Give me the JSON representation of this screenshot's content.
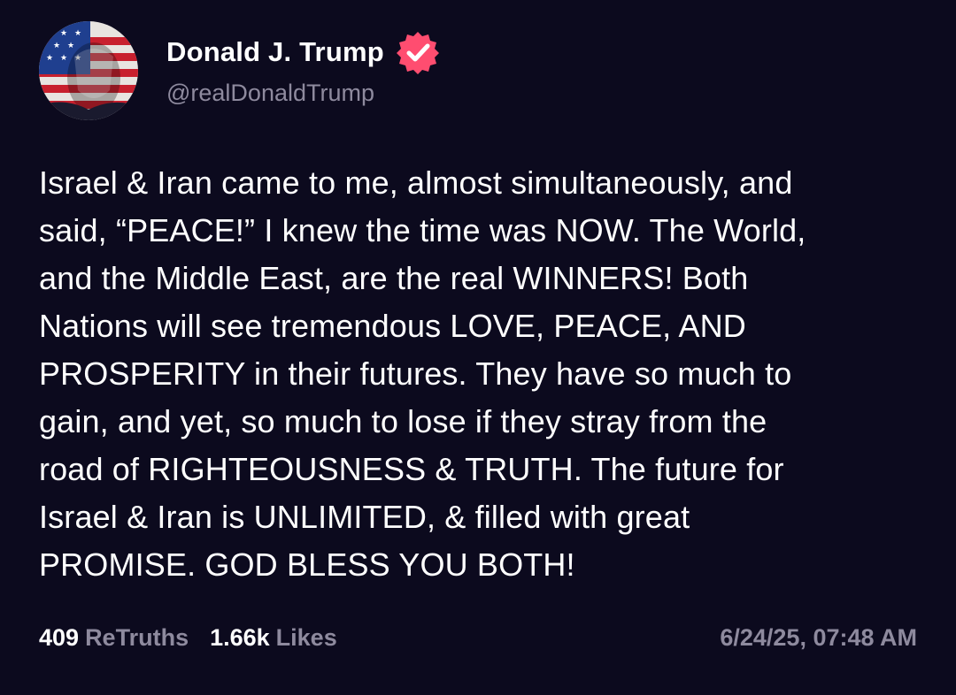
{
  "author": {
    "display_name": "Donald J. Trump",
    "handle": "@realDonaldTrump",
    "avatar_icon": "flag-portrait-avatar",
    "verified_icon": "verified-badge-icon",
    "verified_color": "#ff4d70"
  },
  "post": {
    "text": "Israel & Iran came to me, almost simultaneously, and\nsaid, “PEACE!” I knew the time was NOW. The World,\nand the Middle East, are the real WINNERS! Both\nNations will see tremendous LOVE, PEACE, AND\nPROSPERITY in their futures. They have so much to\ngain, and yet, so much to lose if they stray from the\nroad of RIGHTEOUSNESS & TRUTH. The future for\nIsrael & Iran is UNLIMITED, & filled with great\nPROMISE. GOD BLESS YOU BOTH!"
  },
  "stats": {
    "retruths_count": "409",
    "retruths_label": "ReTruths",
    "likes_count": "1.66k",
    "likes_label": "Likes"
  },
  "timestamp": "6/24/25, 07:48 AM",
  "colors": {
    "background": "#0c0a1e",
    "primary_text": "#ffffff",
    "secondary_text": "#8e8a9e",
    "accent": "#ff4d70"
  }
}
